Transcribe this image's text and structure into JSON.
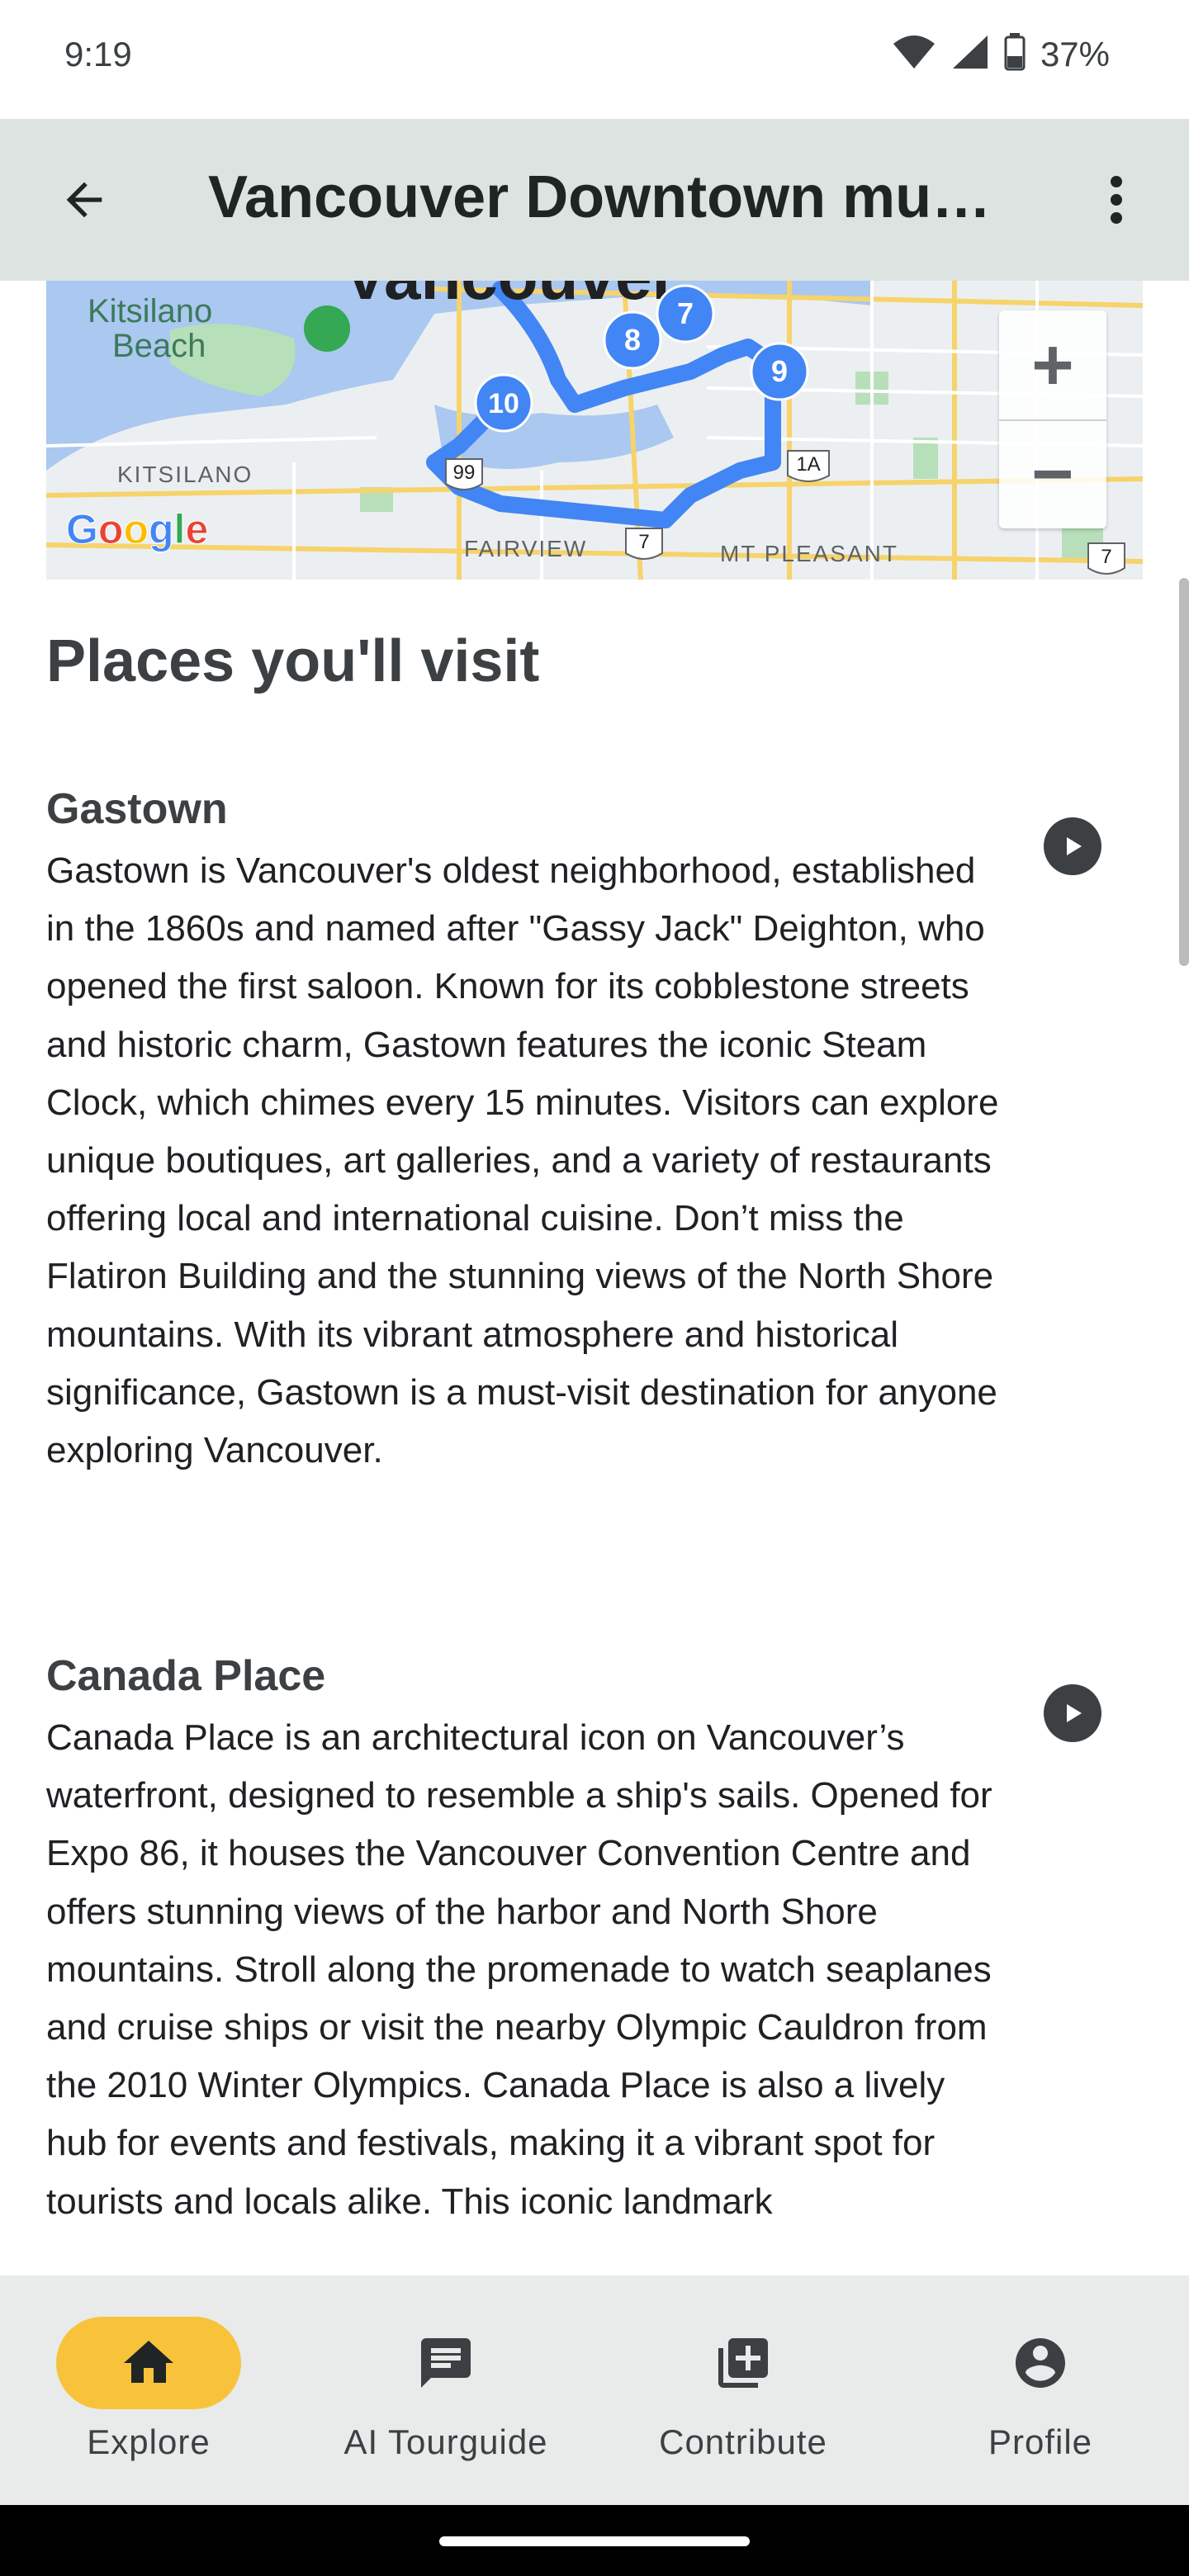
{
  "status_bar": {
    "time": "9:19",
    "battery": "37%"
  },
  "app_bar": {
    "title": "Vancouver Downtown mu…"
  },
  "map": {
    "labels": {
      "kitsilano_beach_1": "Kitsilano",
      "kitsilano_beach_2": "Beach",
      "kitsilano": "KITSILANO",
      "fairview": "FAIRVIEW",
      "mt_pleasant": "MT PLEASANT",
      "city": "Vancouver",
      "google": "Google"
    },
    "markers": [
      "7",
      "8",
      "9",
      "10"
    ],
    "shields": [
      "99",
      "7",
      "1A",
      "7"
    ],
    "zoom_in": "+",
    "zoom_out": "−",
    "colors": {
      "route": "#4285f4",
      "water": "#aac8f0",
      "park": "#b7dfb9",
      "land": "#eceff1"
    }
  },
  "section": {
    "title": "Places you'll visit"
  },
  "places": [
    {
      "name": "Gastown",
      "description": "Gastown is Vancouver's oldest neighborhood, established in the 1860s and named after \"Gassy Jack\" Deighton, who opened the first saloon. Known for its cobblestone streets and historic charm, Gastown features the iconic Steam Clock, which chimes every 15 minutes. Visitors can explore unique boutiques, art galleries, and a variety of restaurants offering local and international cuisine. Don’t miss the Flatiron Building and the stunning views of the North Shore mountains. With its vibrant atmosphere and historical significance, Gastown is a must-visit destination for anyone exploring Vancouver."
    },
    {
      "name": "Canada Place",
      "description": "Canada Place is an architectural icon on Vancouver’s waterfront, designed to resemble a ship's sails. Opened for Expo 86, it houses the Vancouver Convention Centre and offers stunning views of the harbor and North Shore mountains. Stroll along the promenade to watch seaplanes and cruise ships or visit the nearby Olympic Cauldron from the 2010 Winter Olympics. Canada Place is also a lively hub for events and festivals, making it a vibrant spot for tourists and locals alike. This iconic landmark"
    }
  ],
  "bottom_nav": {
    "items": [
      {
        "label": "Explore",
        "icon": "home-icon",
        "active": true
      },
      {
        "label": "AI Tourguide",
        "icon": "chat-icon",
        "active": false
      },
      {
        "label": "Contribute",
        "icon": "add-box-icon",
        "active": false
      },
      {
        "label": "Profile",
        "icon": "account-circle-icon",
        "active": false
      }
    ],
    "active_color": "#f8c33a"
  }
}
